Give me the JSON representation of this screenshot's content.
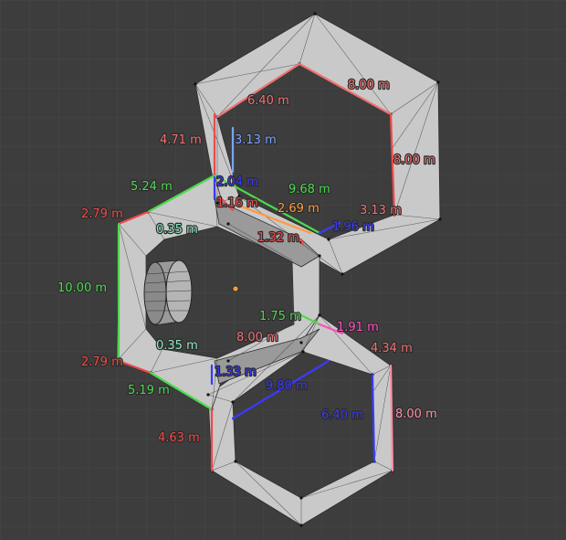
{
  "viewport": {
    "background": "#3d3d3d",
    "grid_color": "#474747",
    "origin_color": "#f0a040"
  },
  "colors": {
    "red": "#ef4a4a",
    "salmon": "#f07070",
    "green": "#4dd94d",
    "mint": "#8fe6c0",
    "blue": "#3a3aff",
    "lightblue": "#7aa2ff",
    "magenta": "#ff4fc0",
    "pink": "#ff8fa8",
    "orange": "#ff9a3c"
  },
  "measurements": [
    {
      "id": "top-hex-edge-upper-left",
      "text": "6.40 m",
      "color": "salmon"
    },
    {
      "id": "top-hex-edge-upper-right",
      "text": "8.00 m",
      "color": "salmon"
    },
    {
      "id": "top-hex-edge-right",
      "text": "8.00 m",
      "color": "salmon"
    },
    {
      "id": "top-hex-left-outer",
      "text": "4.71 m",
      "color": "salmon"
    },
    {
      "id": "top-hex-left-inner",
      "text": "3.13 m",
      "color": "lightblue"
    },
    {
      "id": "top-hex-inner-right",
      "text": "3.13 m",
      "color": "salmon"
    },
    {
      "id": "upper-link-edge",
      "text": "5.24 m",
      "color": "green"
    },
    {
      "id": "upper-vertical",
      "text": "2.04 m",
      "color": "blue"
    },
    {
      "id": "upper-diagonal-long",
      "text": "9.68 m",
      "color": "green"
    },
    {
      "id": "upper-inner-short",
      "text": "1.16 m",
      "color": "red"
    },
    {
      "id": "upper-inner-orange",
      "text": "2.69 m",
      "color": "orange"
    },
    {
      "id": "upper-inner-blue",
      "text": "1.96 m",
      "color": "blue"
    },
    {
      "id": "upper-inner-red",
      "text": "1.32 m",
      "color": "red"
    },
    {
      "id": "left-upper-corner",
      "text": "2.79 m",
      "color": "red"
    },
    {
      "id": "left-upper-inner",
      "text": "0.35 m",
      "color": "mint"
    },
    {
      "id": "left-vertical",
      "text": "10.00 m",
      "color": "green"
    },
    {
      "id": "left-lower-inner",
      "text": "0.35 m",
      "color": "mint"
    },
    {
      "id": "left-lower-corner",
      "text": "2.79 m",
      "color": "red"
    },
    {
      "id": "lower-link-edge",
      "text": "5.19 m",
      "color": "green"
    },
    {
      "id": "middle-short",
      "text": "1.75 m",
      "color": "green"
    },
    {
      "id": "middle-magenta",
      "text": "1.91 m",
      "color": "magenta"
    },
    {
      "id": "lower-hex-upper-left",
      "text": "8.00 m",
      "color": "salmon"
    },
    {
      "id": "lower-hex-upper-right-outer",
      "text": "4.34 m",
      "color": "salmon"
    },
    {
      "id": "lower-inner-vertical",
      "text": "1.33 m",
      "color": "blue"
    },
    {
      "id": "lower-hex-diagonal",
      "text": "9.80 m",
      "color": "blue"
    },
    {
      "id": "lower-hex-inner-right",
      "text": "6.40 m",
      "color": "blue"
    },
    {
      "id": "lower-hex-outer-right",
      "text": "8.00 m",
      "color": "pink"
    },
    {
      "id": "lower-hex-left-outer",
      "text": "4.63 m",
      "color": "red"
    }
  ]
}
